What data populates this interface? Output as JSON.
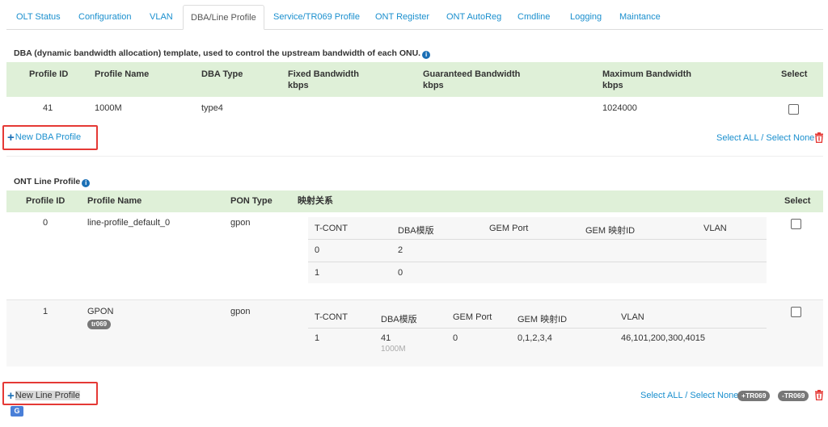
{
  "tabs": [
    {
      "label": "OLT Status",
      "active": false
    },
    {
      "label": "Configuration",
      "active": false
    },
    {
      "label": "VLAN",
      "active": false
    },
    {
      "label": "DBA/Line Profile",
      "active": true
    },
    {
      "label": "Service/TR069 Profile",
      "active": false
    },
    {
      "label": "ONT Register",
      "active": false
    },
    {
      "label": "ONT AutoReg",
      "active": false
    },
    {
      "label": "Cmdline",
      "active": false
    },
    {
      "label": "Logging",
      "active": false
    },
    {
      "label": "Maintance",
      "active": false
    }
  ],
  "dba": {
    "title": "DBA (dynamic bandwidth allocation) template, used to control the upstream bandwidth of each ONU.",
    "headers": {
      "profile_id": "Profile ID",
      "profile_name": "Profile Name",
      "dba_type": "DBA Type",
      "fixed_bw": "Fixed Bandwidth",
      "guaranteed_bw": "Guaranteed Bandwidth",
      "max_bw": "Maximum Bandwidth",
      "unit": "kbps",
      "select": "Select"
    },
    "rows": [
      {
        "profile_id": "41",
        "profile_name": "1000M",
        "dba_type": "type4",
        "fixed_bw": "",
        "guaranteed_bw": "",
        "max_bw": "1024000"
      }
    ],
    "new_label": "New DBA Profile",
    "select_all": "Select ALL",
    "slash": "/",
    "select_none": "Select None"
  },
  "line": {
    "title": "ONT Line Profile",
    "headers": {
      "profile_id": "Profile ID",
      "profile_name": "Profile Name",
      "pon_type": "PON Type",
      "mapping": "映射关系",
      "select": "Select"
    },
    "inner_headers": {
      "tcont": "T-CONT",
      "dba": "DBA模版",
      "gem_port": "GEM Port",
      "gem_map_id": "GEM 映射ID",
      "vlan": "VLAN"
    },
    "rows": [
      {
        "profile_id": "0",
        "profile_name": "line-profile_default_0",
        "pon_type": "gpon",
        "badge": "",
        "mappings": [
          {
            "tcont": "0",
            "dba": "2",
            "dba_sub": "",
            "gem_port": "",
            "gem_map_id": "",
            "vlan": ""
          },
          {
            "tcont": "1",
            "dba": "0",
            "dba_sub": "",
            "gem_port": "",
            "gem_map_id": "",
            "vlan": ""
          }
        ]
      },
      {
        "profile_id": "1",
        "profile_name": "GPON",
        "pon_type": "gpon",
        "badge": "tr069",
        "mappings": [
          {
            "tcont": "1",
            "dba": "41",
            "dba_sub": "1000M",
            "gem_port": "0",
            "gem_map_id": "0,1,2,3,4",
            "vlan": "46,101,200,300,4015"
          }
        ]
      }
    ],
    "new_label": "New Line Profile",
    "select_all": "Select ALL",
    "slash": "/",
    "select_none": "Select None",
    "add_tr069": "+TR069",
    "remove_tr069": "-TR069"
  },
  "colors": {
    "link": "#1a8fce",
    "table_header_bg": "#dff0d8",
    "highlight_box": "#e53935",
    "delete_icon": "#e53935"
  },
  "icons": {
    "info": "info-circle-icon",
    "add": "plus-icon",
    "delete": "trash-icon",
    "translate": "translate-icon"
  }
}
